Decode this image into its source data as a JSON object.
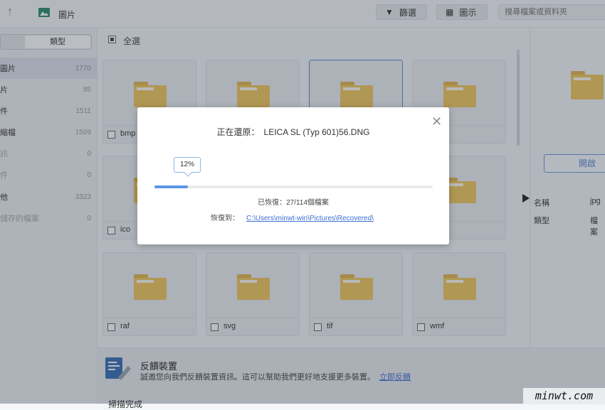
{
  "topbar": {
    "crumb": "圖片",
    "filter_label": "篩選",
    "view_label": "圖示",
    "search_placeholder": "搜尋檔案或資料夾"
  },
  "sidebar": {
    "segment_type": "類型",
    "items": [
      {
        "label": "圖片",
        "count": "1770"
      },
      {
        "label": "片",
        "count": "85"
      },
      {
        "label": "件",
        "count": "1511"
      },
      {
        "label": "縮檔",
        "count": "1569"
      },
      {
        "label": "訊",
        "count": "0"
      },
      {
        "label": "件",
        "count": "0"
      },
      {
        "label": "他",
        "count": "3323"
      },
      {
        "label": "儲存的檔案",
        "count": "0"
      }
    ]
  },
  "main": {
    "select_all": "全選",
    "cards": [
      {
        "name": "bmp"
      },
      {
        "name": ""
      },
      {
        "name": ""
      },
      {
        "name": ""
      },
      {
        "name": "ico"
      },
      {
        "name": ""
      },
      {
        "name": ""
      },
      {
        "name": ""
      },
      {
        "name": "raf"
      },
      {
        "name": "svg"
      },
      {
        "name": "tif"
      },
      {
        "name": "wmf"
      }
    ]
  },
  "right_panel": {
    "open_label": "開啟",
    "props": [
      {
        "key": "名稱",
        "value": "jpg"
      },
      {
        "key": "類型",
        "value": "檔案"
      }
    ]
  },
  "banner": {
    "title": "反饋裝置",
    "text": "誠邀您向我們反饋裝置資訊。這可以幫助我們更好地支援更多裝置。",
    "link": "立即反饋",
    "cut_text": "掃描完成"
  },
  "watermark": "minwt.com",
  "dialog": {
    "restoring_label": "正在還原：",
    "restoring_file": "LEICA SL (Typ 601)56.DNG",
    "percent_text": "12%",
    "progress": 0.12,
    "recovered_text": "已恢復：27/114個檔案",
    "recover_to_label": "恢復到：",
    "recover_path": "C:\\Users\\minwt-win\\Pictures\\Recovered\\"
  },
  "colors": {
    "accent": "#5c97e8",
    "folder": "#f0c75c",
    "link": "#3d6fd1"
  }
}
